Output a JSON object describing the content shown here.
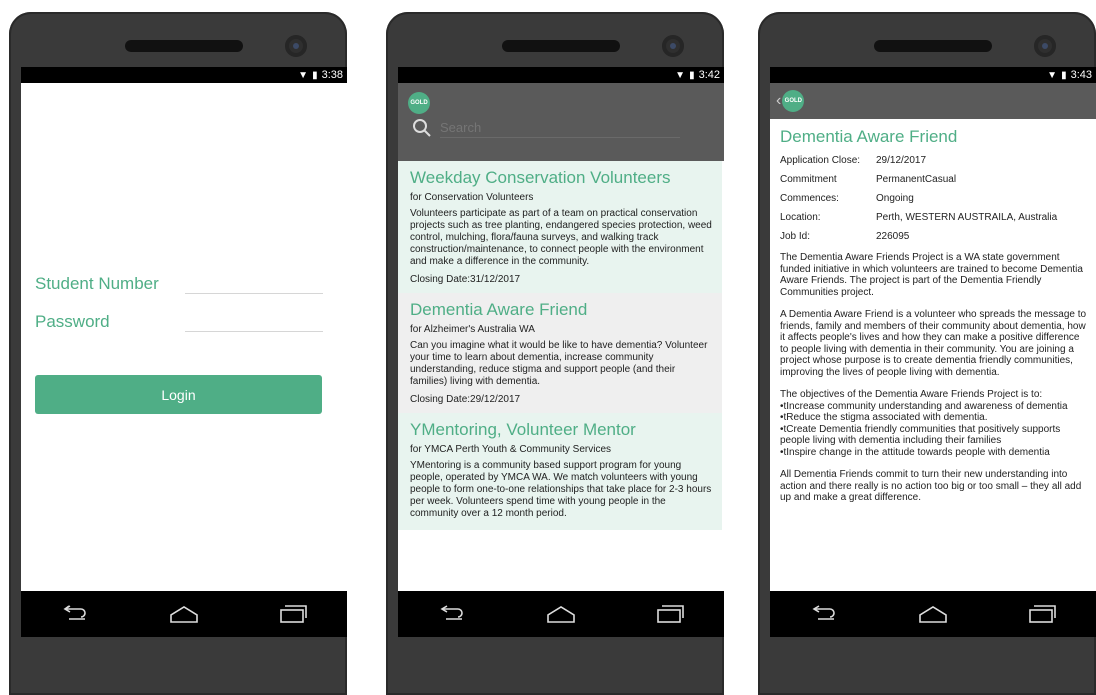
{
  "phone1": {
    "status": {
      "time": "3:38"
    },
    "login": {
      "student_number_label": "Student Number",
      "password_label": "Password",
      "login_button": "Login"
    }
  },
  "phone2": {
    "status": {
      "time": "3:42"
    },
    "search": {
      "placeholder": "Search"
    },
    "logo_text": "GOLD",
    "cards": [
      {
        "title": "Weekday Conservation Volunteers",
        "org": "for Conservation Volunteers",
        "body": "Volunteers participate as part of a team on practical conservation projects such as tree planting, endangered species protection, weed control, mulching, flora/fauna surveys, and walking track construction/maintenance, to connect people with the environment and make a difference in the community.",
        "closing": "Closing Date:31/12/2017"
      },
      {
        "title": "Dementia Aware Friend",
        "org": "for Alzheimer's Australia WA",
        "body": "Can you imagine what it would be like to have dementia? Volunteer your time to learn about dementia, increase community understanding, reduce stigma and support people (and their families) living with dementia.",
        "closing": "Closing Date:29/12/2017"
      },
      {
        "title": "YMentoring, Volunteer Mentor",
        "org": "for YMCA Perth Youth & Community Services",
        "body": "YMentoring is a community based support program for young people, operated by YMCA WA. We match volunteers with young people to form one-to-one relationships that take place for 2-3 hours per week. Volunteers spend time with young people in the community over a 12 month period.",
        "closing": ""
      }
    ]
  },
  "phone3": {
    "status": {
      "time": "3:43"
    },
    "logo_text": "GOLD",
    "back_glyph": "‹",
    "title": "Dementia Aware Friend",
    "fields": [
      {
        "key": "Application Close:",
        "value": "29/12/2017"
      },
      {
        "key": "Commitment",
        "value": "PermanentCasual"
      },
      {
        "key": "Commences:",
        "value": "Ongoing"
      },
      {
        "key": "Location:",
        "value": "Perth, WESTERN AUSTRAILA, Australia"
      },
      {
        "key": "Job Id:",
        "value": "226095"
      }
    ],
    "para1": "The Dementia Aware Friends Project is a WA state government funded initiative in which volunteers are trained to become Dementia Aware Friends. The project is part of the Dementia Friendly Communities project.",
    "para2": "A Dementia Aware Friend is a volunteer who spreads the message to friends, family and members of their community about dementia, how it affects people's lives and how they can make a positive difference to people living with dementia in their community. You are joining a project whose purpose is to create dementia friendly communities, improving the lives of people living with dementia.",
    "para3_intro": "The objectives of the Dementia Aware Friends Project is to:",
    "bullets": [
      "•tIncrease community understanding and awareness of dementia",
      "•tReduce the stigma associated with dementia.",
      "•tCreate Dementia friendly communities that positively supports people living with dementia including their families",
      "•tInspire change in the attitude towards people with dementia"
    ],
    "para4": "All Dementia Friends commit to turn their new understanding into action and there really is no action too big or too small – they all add up and make a great difference."
  }
}
